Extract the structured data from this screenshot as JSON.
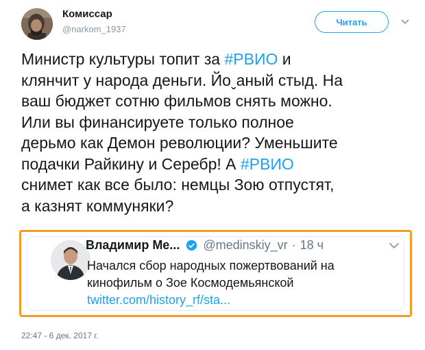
{
  "author": {
    "name": "Комиссар",
    "handle": "@narkom_1937"
  },
  "follow_label": "Читать",
  "tweet": {
    "lines": [
      [
        {
          "text": "Министр культуры топит за "
        },
        {
          "text": "#РВИО",
          "hashtag": true
        },
        {
          "text": " и"
        }
      ],
      [
        {
          "text": "клянчит у народа деньги. Йоˬаный стыд. На"
        }
      ],
      [
        {
          "text": "ваш бюджет сотню фильмов снять можно."
        }
      ],
      [
        {
          "text": "Или вы финансируете только полное"
        }
      ],
      [
        {
          "text": "дерьмо как Демон революции? Уменьшите"
        }
      ],
      [
        {
          "text": "подачки Райкину и Серебр! А "
        },
        {
          "text": "#РВИО",
          "hashtag": true
        }
      ],
      [
        {
          "text": "снимет как все было: немцы Зою отпустят,"
        }
      ],
      [
        {
          "text": "а казнят коммуняки?"
        }
      ]
    ],
    "timestamp": "22:47 - 6 дек. 2017 г."
  },
  "quoted": {
    "name": "Владимир Ме...",
    "handle": "@medinskiy_vr",
    "separator": "·",
    "time": "18 ч",
    "lines": [
      "Начался сбор народных пожертвований на",
      "кинофильм о Зое Космодемьянской"
    ],
    "link": "twitter.com/history_rf/sta...",
    "highlight_color": "#f59b24"
  },
  "icons": {
    "caret": "chevron-down-icon",
    "verified": "verified-badge-icon"
  },
  "colors": {
    "accent": "#1da1f2",
    "text": "#14171a",
    "muted": "#657786"
  }
}
